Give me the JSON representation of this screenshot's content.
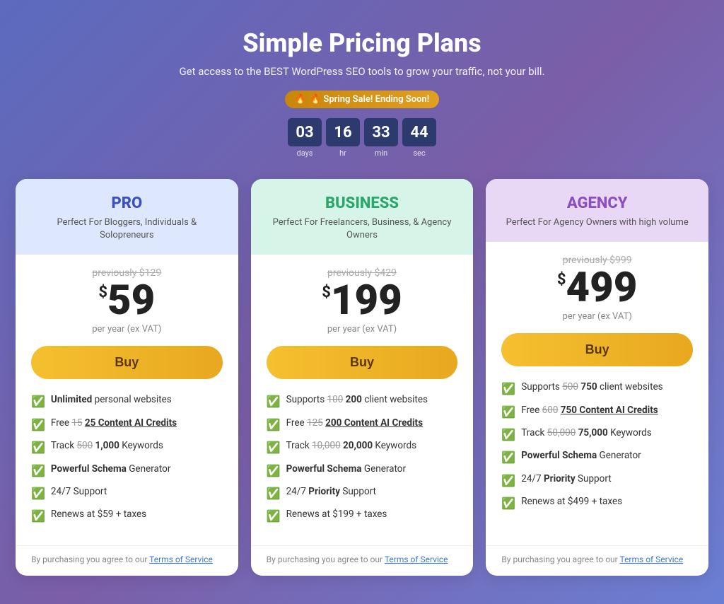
{
  "header": {
    "title": "Simple Pricing Plans",
    "subtitle": "Get access to the BEST WordPress SEO tools to grow your traffic, not your bill.",
    "sale_badge": "🔥 Spring Sale! Ending Soon!",
    "countdown": {
      "days": "03",
      "hours": "16",
      "minutes": "33",
      "seconds": "44",
      "labels": [
        "days",
        "hr",
        "min",
        "sec"
      ]
    }
  },
  "plans": [
    {
      "id": "pro",
      "name": "PRO",
      "description": "Perfect For Bloggers, Individuals & Solopreneurs",
      "old_price": "previously $129",
      "price_dollar": "$",
      "price_amount": "59",
      "per_year": "per year (ex VAT)",
      "buy_label": "Buy",
      "features": [
        {
          "bold": "Unlimited",
          "text": " personal websites"
        },
        {
          "strikethrough": "15",
          "bold": " 25",
          "text": " Content AI Credits",
          "underline": true
        },
        {
          "text": "Track ",
          "strikethrough": "500",
          "bold": " 1,000",
          "text2": " Keywords"
        },
        {
          "bold": "Powerful Schema",
          "text": " Generator"
        },
        {
          "text": "24/7 Support"
        },
        {
          "text": "Renews at $59 + taxes"
        }
      ],
      "footer": "By purchasing you agree to our Terms of Service"
    },
    {
      "id": "business",
      "name": "BUSINESS",
      "description": "Perfect For Freelancers, Business, & Agency Owners",
      "old_price": "previously $429",
      "price_dollar": "$",
      "price_amount": "199",
      "per_year": "per year (ex VAT)",
      "buy_label": "Buy",
      "features": [
        {
          "text": "Supports ",
          "strikethrough": "100",
          "bold": " 200",
          "text2": " client websites"
        },
        {
          "text": "Free ",
          "strikethrough": "125",
          "bold": " 200",
          "text2": " Content AI Credits",
          "underline": true
        },
        {
          "text": "Track ",
          "strikethrough": "10,000",
          "bold": " 20,000",
          "text2": " Keywords"
        },
        {
          "bold": "Powerful Schema",
          "text": " Generator"
        },
        {
          "text": "24/7 ",
          "bold": "Priority",
          "text2": " Support"
        },
        {
          "text": "Renews at $199 + taxes"
        }
      ],
      "footer": "By purchasing you agree to our Terms of Service"
    },
    {
      "id": "agency",
      "name": "AGENCY",
      "description": "Perfect For Agency Owners with high volume",
      "old_price": "previously $999",
      "price_dollar": "$",
      "price_amount": "499",
      "per_year": "per year (ex VAT)",
      "buy_label": "Buy",
      "features": [
        {
          "text": "Supports ",
          "strikethrough": "500",
          "bold": " 750",
          "text2": " client websites"
        },
        {
          "text": "Free ",
          "strikethrough": "600",
          "bold": " 750",
          "text2": " Content AI Credits",
          "underline": true
        },
        {
          "text": "Track ",
          "strikethrough": "50,000",
          "bold": " 75,000",
          "text2": " Keywords"
        },
        {
          "bold": "Powerful Schema",
          "text": " Generator"
        },
        {
          "text": "24/7 ",
          "bold": "Priority",
          "text2": " Support"
        },
        {
          "text": "Renews at $499 + taxes"
        }
      ],
      "footer": "By purchasing you agree to our Terms of Service"
    }
  ]
}
